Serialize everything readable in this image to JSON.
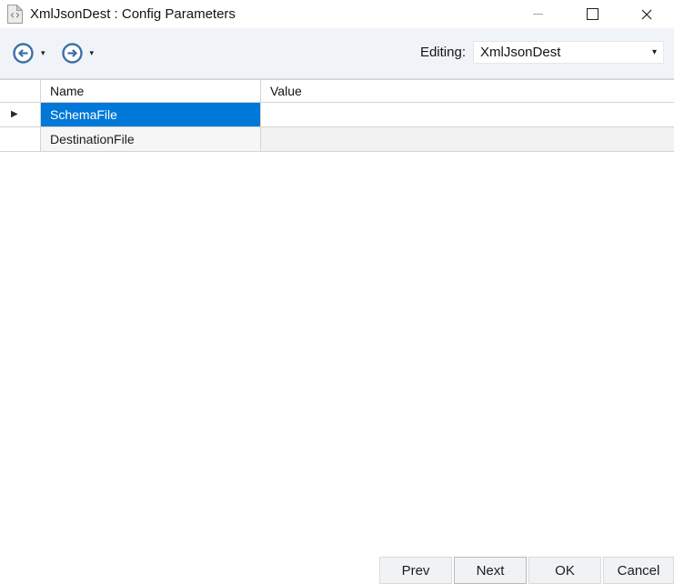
{
  "window": {
    "title": "XmlJsonDest : Config Parameters"
  },
  "icons": {
    "dropdown_caret": "▾",
    "combo_caret": "▾",
    "row_selector_arrow": "▶",
    "close_glyph": "✕"
  },
  "toolbar": {
    "back_icon": "circle-arrow-left",
    "forward_icon": "circle-arrow-right",
    "editing_label": "Editing:",
    "editing_value": "XmlJsonDest"
  },
  "grid": {
    "columns": [
      "Name",
      "Value"
    ],
    "rows": [
      {
        "name": "SchemaFile",
        "value": "",
        "selected": true
      },
      {
        "name": "DestinationFile",
        "value": "",
        "selected": false
      }
    ]
  },
  "footer": {
    "buttons": {
      "prev": "Prev",
      "next": "Next",
      "ok": "OK",
      "cancel": "Cancel"
    }
  },
  "colors": {
    "selection_accent": "#0078d7",
    "nav_icon_blue": "#3f6fa8",
    "toolbar_background": "#f0f4f8"
  }
}
